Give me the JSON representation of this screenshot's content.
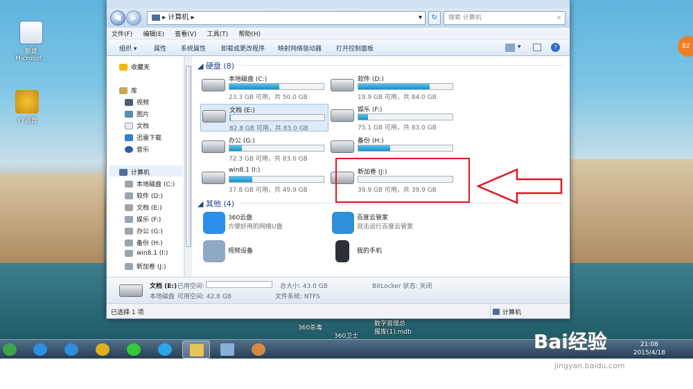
{
  "desktop": {
    "icons": [
      {
        "label": "新建\nMicrosof...",
        "icon": "word-doc-icon"
      },
      {
        "label": "YY语音",
        "icon": "yy-voice-icon"
      }
    ],
    "bottom_labels": {
      "a": "360杀毒",
      "b": "360卫士",
      "c": "数字音理总",
      "d": "报库(1).mdb"
    }
  },
  "window": {
    "address": {
      "path": "计算机",
      "separator": "▸"
    },
    "search_placeholder": "搜索 计算机",
    "menu": [
      "文件(F)",
      "编辑(E)",
      "查看(V)",
      "工具(T)",
      "帮助(H)"
    ],
    "toolbar": [
      "组织 ▾",
      "属性",
      "系统属性",
      "卸载或更改程序",
      "映射网络驱动器",
      "打开控制面板"
    ],
    "nav": [
      {
        "label": "收藏夹",
        "icon": "star-icon"
      },
      {
        "label": "库",
        "icon": "library-icon"
      },
      {
        "label": "视频",
        "icon": "video-icon"
      },
      {
        "label": "图片",
        "icon": "picture-icon"
      },
      {
        "label": "文档",
        "icon": "document-icon"
      },
      {
        "label": "迅雷下载",
        "icon": "download-icon"
      },
      {
        "label": "音乐",
        "icon": "music-icon"
      },
      {
        "label": "计算机",
        "icon": "computer-icon"
      },
      {
        "label": "本地磁盘 (C:)",
        "icon": "drive-icon"
      },
      {
        "label": "软件 (D:)",
        "icon": "drive-icon"
      },
      {
        "label": "文档 (E:)",
        "icon": "drive-icon"
      },
      {
        "label": "娱乐 (F:)",
        "icon": "drive-icon"
      },
      {
        "label": "办公 (G:)",
        "icon": "drive-icon"
      },
      {
        "label": "备份 (H:)",
        "icon": "drive-icon"
      },
      {
        "label": "win8.1 (I:)",
        "icon": "drive-icon"
      },
      {
        "label": "新加卷 (J:)",
        "icon": "drive-icon"
      }
    ],
    "groups": {
      "drives": "硬盘 (8)",
      "other": "其他 (4)"
    },
    "drives": [
      {
        "name": "本地磁盘 (C:)",
        "size": "23.3 GB 可用，共 50.0 GB",
        "used": 0.53
      },
      {
        "name": "软件 (D:)",
        "size": "19.9 GB 可用，共 84.0 GB",
        "used": 0.76
      },
      {
        "name": "文档 (E:)",
        "size": "82.8 GB 可用，共 83.0 GB",
        "used": 0.01
      },
      {
        "name": "娱乐 (F:)",
        "size": "75.1 GB 可用，共 83.0 GB",
        "used": 0.1
      },
      {
        "name": "办公 (G:)",
        "size": "72.3 GB 可用，共 83.0 GB",
        "used": 0.13
      },
      {
        "name": "备份 (H:)",
        "size": "",
        "used": 0.34
      },
      {
        "name": "win8.1 (I:)",
        "size": "37.8 GB 可用，共 49.9 GB",
        "used": 0.24
      },
      {
        "name": "新加卷 (J:)",
        "size": "39.9 GB 可用，共 39.9 GB",
        "used": 0.0
      }
    ],
    "others": [
      {
        "name": "360云盘",
        "desc": "方便好用的网络U盘",
        "icon": "cloud-drive-icon",
        "color": "#2b8ee8"
      },
      {
        "name": "百度云管家",
        "desc": "双击运行百度云管家",
        "icon": "baidu-cloud-icon",
        "color": "#2f8fd8"
      },
      {
        "name": "视频设备",
        "desc": "",
        "icon": "webcam-icon",
        "color": "#8fa8c4"
      },
      {
        "name": "我的手机",
        "desc": "",
        "icon": "phone-icon",
        "color": "#2a2f38"
      }
    ],
    "details": {
      "drive": "文档 (E:)",
      "used_label": "已用空间:",
      "type": "本地磁盘",
      "free": "可用空间: 42.8 GB",
      "total": "总大小: 43.0 GB",
      "fs": "文件系统: NTFS",
      "bitlocker": "BitLocker 状态: 关闭"
    },
    "status": {
      "left": "已选择 1 项",
      "right": "计算机"
    }
  },
  "taskbar": {
    "apps": [
      {
        "name": "start-orb-icon",
        "color": "#3aa64a"
      },
      {
        "name": "ie-icon",
        "color": "#2d8fe0"
      },
      {
        "name": "baidu-cloud-icon",
        "color": "#2f8fd8"
      },
      {
        "name": "chrome-icon",
        "color": "#e0b020"
      },
      {
        "name": "wechat-icon",
        "color": "#35c83b"
      },
      {
        "name": "browser-icon",
        "color": "#2aa6e8"
      },
      {
        "name": "explorer-icon",
        "color": "#e8c45a"
      },
      {
        "name": "network-icon",
        "color": "#8ab0d8"
      },
      {
        "name": "paint-icon",
        "color": "#d58a44"
      }
    ],
    "time": "21:08",
    "date": "2015/4/18"
  },
  "watermark": {
    "logo": "Bai经验",
    "url": "jingyan.baidu.com"
  },
  "colors": {
    "accent": "#1a8fc6",
    "highlight": "#e0141e"
  }
}
